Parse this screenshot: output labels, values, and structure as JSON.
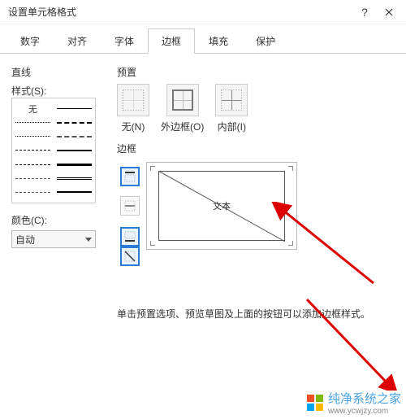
{
  "titlebar": {
    "title": "设置单元格格式"
  },
  "tabs": {
    "items": [
      {
        "label": "数字"
      },
      {
        "label": "对齐"
      },
      {
        "label": "字体"
      },
      {
        "label": "边框"
      },
      {
        "label": "填充"
      },
      {
        "label": "保护"
      }
    ],
    "active_index": 3
  },
  "line": {
    "section_label": "直线",
    "style_label": "样式(S):",
    "none_label": "无",
    "color_label": "颜色(C):",
    "color_value": "自动"
  },
  "presets": {
    "section_label": "预置",
    "items": [
      {
        "label": "无(N)"
      },
      {
        "label": "外边框(O)"
      },
      {
        "label": "内部(I)"
      }
    ]
  },
  "border": {
    "section_label": "边框",
    "preview_text": "文本"
  },
  "hint": "单击预置选项、预览草图及上面的按钮可以添加边框样式。",
  "watermark": {
    "brand": "纯净系统之家",
    "url": "www.ycwjzy.com"
  }
}
